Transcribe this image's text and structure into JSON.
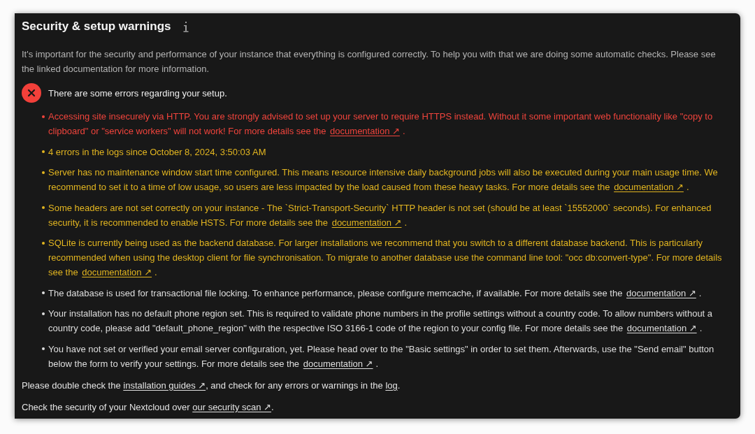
{
  "title": "Security & setup warnings",
  "intro": "It's important for the security and performance of your instance that everything is configured correctly. To help you with that we are doing some automatic checks. Please see the linked documentation for more information.",
  "status": {
    "kind": "error",
    "text": "There are some errors regarding your setup."
  },
  "items": [
    {
      "kind": "error",
      "parts": [
        {
          "kind": "text",
          "text": "Accessing site insecurely via HTTP. You are strongly advised to set up your server to require HTTPS instead. Without it some important web functionality like \"copy to clipboard\" or \"service workers\" will not work! For more details see the "
        },
        {
          "kind": "link",
          "text": "documentation ↗"
        },
        {
          "kind": "text",
          "text": "."
        }
      ]
    },
    {
      "kind": "warning",
      "parts": [
        {
          "kind": "text",
          "text": "4 errors in the logs since October 8, 2024, 3:50:03 AM"
        }
      ]
    },
    {
      "kind": "warning",
      "parts": [
        {
          "kind": "text",
          "text": "Server has no maintenance window start time configured. This means resource intensive daily background jobs will also be executed during your main usage time. We recommend to set it to a time of low usage, so users are less impacted by the load caused from these heavy tasks. For more details see the "
        },
        {
          "kind": "link",
          "text": "documentation ↗"
        },
        {
          "kind": "text",
          "text": "."
        }
      ]
    },
    {
      "kind": "warning",
      "parts": [
        {
          "kind": "text",
          "text": "Some headers are not set correctly on your instance - The `Strict-Transport-Security` HTTP header is not set (should be at least `15552000` seconds). For enhanced security, it is recommended to enable HSTS. For more details see the "
        },
        {
          "kind": "link",
          "text": "documentation ↗"
        },
        {
          "kind": "text",
          "text": "."
        }
      ]
    },
    {
      "kind": "warning",
      "parts": [
        {
          "kind": "text",
          "text": "SQLite is currently being used as the backend database. For larger installations we recommend that you switch to a different database backend. This is particularly recommended when using the desktop client for file synchronisation. To migrate to another database use the command line tool: \"occ db:convert-type\". For more details see the "
        },
        {
          "kind": "link",
          "text": "documentation ↗"
        },
        {
          "kind": "text",
          "text": "."
        }
      ]
    },
    {
      "kind": "info",
      "parts": [
        {
          "kind": "text",
          "text": "The database is used for transactional file locking. To enhance performance, please configure memcache, if available. For more details see the "
        },
        {
          "kind": "link",
          "text": "documentation ↗"
        },
        {
          "kind": "text",
          "text": "."
        }
      ]
    },
    {
      "kind": "info",
      "parts": [
        {
          "kind": "text",
          "text": "Your installation has no default phone region set. This is required to validate phone numbers in the profile settings without a country code. To allow numbers without a country code, please add \"default_phone_region\" with the respective ISO 3166-1 code of the region to your config file. For more details see the "
        },
        {
          "kind": "link",
          "text": "documentation ↗"
        },
        {
          "kind": "text",
          "text": "."
        }
      ]
    },
    {
      "kind": "info",
      "parts": [
        {
          "kind": "text",
          "text": "You have not set or verified your email server configuration, yet. Please head over to the \"Basic settings\" in order to set them. Afterwards, use the \"Send email\" button below the form to verify your settings. For more details see the "
        },
        {
          "kind": "link",
          "text": "documentation ↗"
        },
        {
          "kind": "text",
          "text": "."
        }
      ]
    }
  ],
  "footer": [
    {
      "parts": [
        {
          "kind": "text",
          "text": "Please double check the "
        },
        {
          "kind": "link",
          "text": "installation guides ↗"
        },
        {
          "kind": "text",
          "text": ", and check for any errors or warnings in the "
        },
        {
          "kind": "link",
          "text": "log"
        },
        {
          "kind": "text",
          "text": "."
        }
      ]
    },
    {
      "parts": [
        {
          "kind": "text",
          "text": "Check the security of your Nextcloud over "
        },
        {
          "kind": "link",
          "text": "our security scan ↗"
        },
        {
          "kind": "text",
          "text": "."
        }
      ]
    }
  ]
}
